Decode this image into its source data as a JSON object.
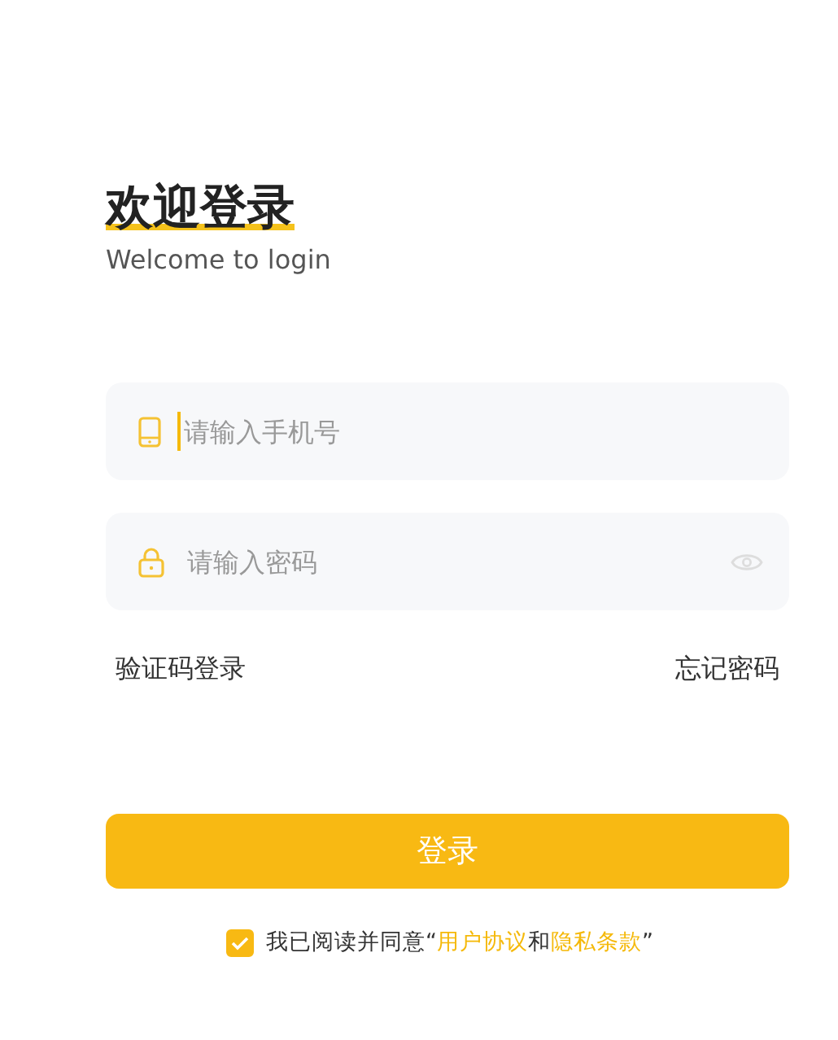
{
  "title": "欢迎登录",
  "subtitle": "Welcome to login",
  "fields": [
    {
      "kind": "phone",
      "placeholder": "请输入手机号",
      "focused": true
    },
    {
      "kind": "password",
      "placeholder": "请输入密码",
      "focused": false
    }
  ],
  "links": [
    "验证码登录",
    "忘记密码"
  ],
  "login_button": "登录",
  "agreement": {
    "checked": true,
    "prefix": "我已阅读并同意“",
    "terms_link": "用户协议",
    "joiner": "和",
    "privacy_link": "隐私条款",
    "suffix": "”"
  }
}
